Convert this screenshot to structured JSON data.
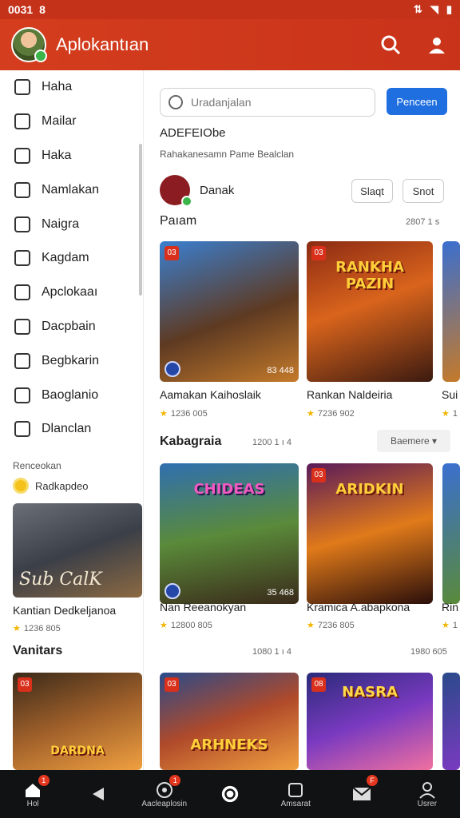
{
  "status_bar": {
    "time": "0031",
    "glyph": "8"
  },
  "app": {
    "title": "Aplokantıan"
  },
  "sidebar": {
    "items": [
      {
        "label": "Haha",
        "icon": "home-icon"
      },
      {
        "label": "Mailar",
        "icon": "gamepad-icon"
      },
      {
        "label": "Haka",
        "icon": "bag-icon"
      },
      {
        "label": "Namlakan",
        "icon": "list-icon"
      },
      {
        "label": "Naigra",
        "icon": "card-icon"
      },
      {
        "label": "Kagdam",
        "icon": "window-icon"
      },
      {
        "label": "Apclokaaı",
        "icon": "hand-icon"
      },
      {
        "label": "Dacpbain",
        "icon": "puzzle-icon"
      },
      {
        "label": "Begbkarin",
        "icon": "compass-icon"
      },
      {
        "label": "Baoglanio",
        "icon": "tools-icon"
      },
      {
        "label": "Dlanclan",
        "icon": "folder-icon"
      }
    ],
    "section_label": "Renceokan",
    "tag_label": "Radkapdeo",
    "promo_card": {
      "art_text": "Sub CalK",
      "title": "Kantian Dedkeljanoa",
      "meta": "1236 805"
    }
  },
  "search": {
    "placeholder": "Uradanjalan",
    "button_label": "Penceen"
  },
  "header_section": {
    "title": "ADEFEIObe",
    "subtitle": "Rahakanesamn Pame Bealclan"
  },
  "profile": {
    "name": "Danak",
    "btn1": "Slaqt",
    "btn2": "Snot"
  },
  "rows": [
    {
      "label": "Paıam",
      "count": "2807 1 s",
      "cards": [
        {
          "badge": "03",
          "art_title": "",
          "stats": "83 448",
          "title": "Aamakan Kaihoslaik",
          "meta": "1236 005"
        },
        {
          "badge": "03",
          "art_title": "RANKHA PAZIN",
          "stats": "",
          "title": "Rankan Naldeiria",
          "meta": "7236 902"
        },
        {
          "badge": "",
          "art_title": "",
          "stats": "",
          "title": "Sui",
          "meta": "1"
        }
      ]
    },
    {
      "label": "Kabagraia",
      "count": "1200 1 ı 4",
      "filter": "Baemere",
      "cards": [
        {
          "badge": "",
          "art_title": "CHIDEAS",
          "stats": "35 468",
          "title": "Nan Reeanokyan",
          "meta": "12800 805"
        },
        {
          "badge": "03",
          "art_title": "ARIDKIN",
          "stats": "",
          "title": "Kramica A.abapkona",
          "meta": "7236 805"
        },
        {
          "badge": "",
          "art_title": "",
          "stats": "",
          "title": "Rin",
          "meta": "1"
        }
      ]
    },
    {
      "label": "Vanitars",
      "count": "1080 1 ı 4",
      "count2": "1980 605",
      "cards": [
        {
          "badge": "03",
          "art_title": "DARDNA",
          "stats": "",
          "title": "",
          "meta": ""
        },
        {
          "badge": "03",
          "art_title": "ARHNEKS",
          "stats": "",
          "title": "",
          "meta": ""
        },
        {
          "badge": "08",
          "art_title": "NASRA",
          "stats": "",
          "title": "",
          "meta": ""
        }
      ]
    }
  ],
  "bottom_nav": [
    {
      "label": "Hol",
      "icon": "home-icon",
      "badge": "1"
    },
    {
      "label": "",
      "icon": "back-icon",
      "badge": ""
    },
    {
      "label": "Aacleaplosin",
      "icon": "target-icon",
      "badge": "1"
    },
    {
      "label": "",
      "icon": "refresh-icon",
      "badge": ""
    },
    {
      "label": "Amsarat",
      "icon": "camera-icon",
      "badge": ""
    },
    {
      "label": "",
      "icon": "mail-icon",
      "badge": "F"
    },
    {
      "label": "Usrer",
      "icon": "user-icon",
      "badge": ""
    }
  ],
  "colors": {
    "appbar": "#c9331a",
    "search_button": "#1f6fe0",
    "bottom_nav": "#111214",
    "star": "#f4b400"
  }
}
